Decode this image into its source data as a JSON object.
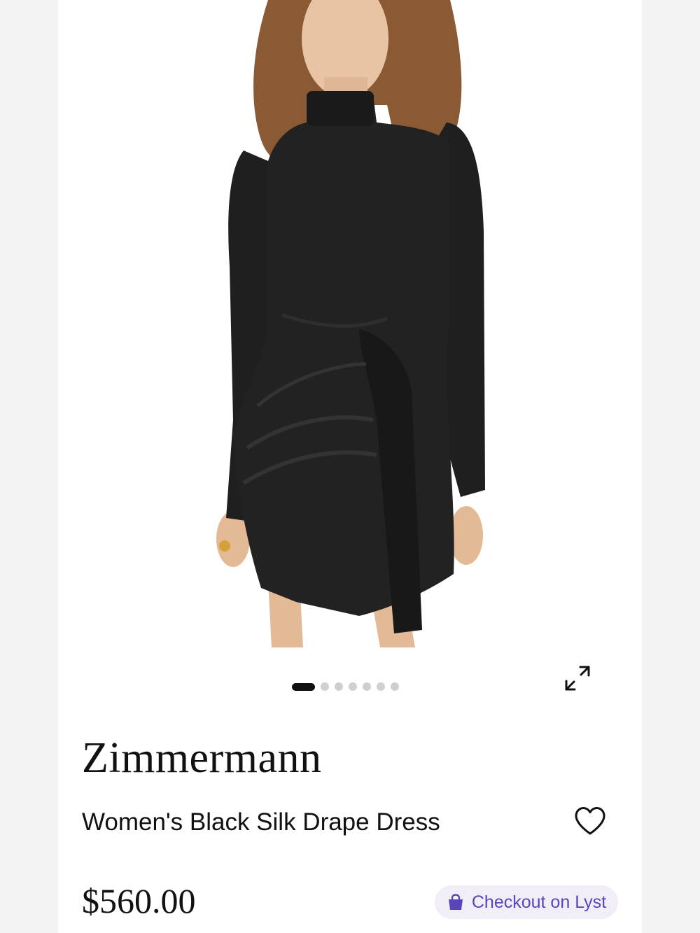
{
  "product": {
    "brand": "Zimmermann",
    "name": "Women's Black Silk Drape Dress",
    "price": "$560.00"
  },
  "carousel": {
    "image_count": 7,
    "active_index": 0
  },
  "actions": {
    "checkout_label": "Checkout on Lyst",
    "expand_icon": "expand-arrows-icon",
    "favorite_icon": "heart-outline-icon",
    "checkout_icon": "shopping-bag-icon"
  },
  "colors": {
    "checkout_accent": "#5b45b8",
    "checkout_background": "#f1eef8",
    "text": "#111111"
  }
}
